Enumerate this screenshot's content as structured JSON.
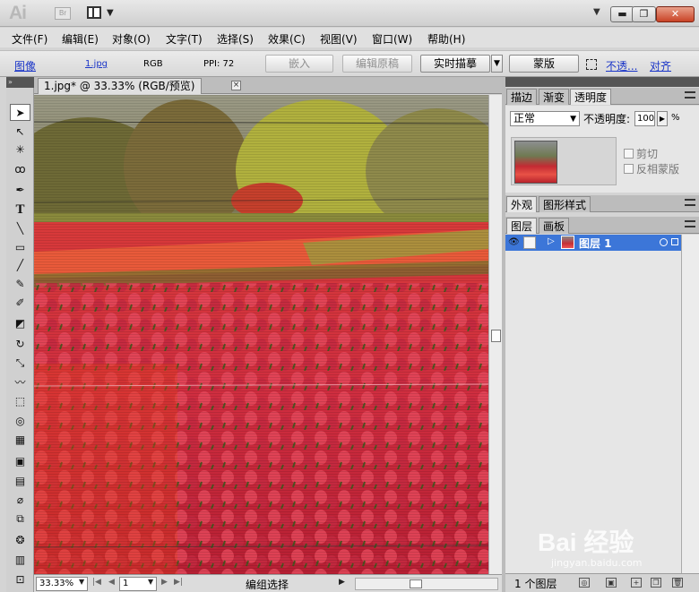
{
  "titlebar": {
    "logo": "Ai",
    "bridge": "Br",
    "window_controls": [
      "minimize",
      "restore",
      "close"
    ]
  },
  "menubar": {
    "items": [
      "文件(F)",
      "编辑(E)",
      "对象(O)",
      "文字(T)",
      "选择(S)",
      "效果(C)",
      "视图(V)",
      "窗口(W)",
      "帮助(H)"
    ]
  },
  "controlbar": {
    "object_type": "图像",
    "filename": "1.jpg",
    "color_mode": "RGB",
    "ppi": "PPI: 72",
    "embed": "嵌入",
    "edit_original": "编辑原稿",
    "live_trace": "实时描摹",
    "mask": "蒙版",
    "opacity_link": "不透...",
    "align_link": "对齐"
  },
  "document": {
    "tab_title": "1.jpg* @ 33.33% (RGB/预览)",
    "tab_close": "×"
  },
  "statusbar": {
    "zoom": "33.33%",
    "page": "1",
    "status": "编组选择"
  },
  "transparency_panel": {
    "tabs": [
      "描边",
      "渐变",
      "透明度"
    ],
    "blend_mode": "正常",
    "opacity_label": "不透明度:",
    "opacity_value": "100",
    "percent": "%",
    "clip_label": "剪切",
    "invert_label": "反相蒙版"
  },
  "appearance_panel": {
    "tabs": [
      "外观",
      "图形样式"
    ]
  },
  "layers_panel": {
    "tabs": [
      "图层",
      "画板"
    ],
    "layer_name": "图层 1",
    "layer_count": "1 个图层"
  },
  "watermark": {
    "text": "Bai 经验",
    "url": "jingyan.baidu.com"
  },
  "colors": {
    "selection_blue": "#3c76d8",
    "link_blue": "#1a35c8",
    "panel_gray": "#e6e6e6"
  }
}
